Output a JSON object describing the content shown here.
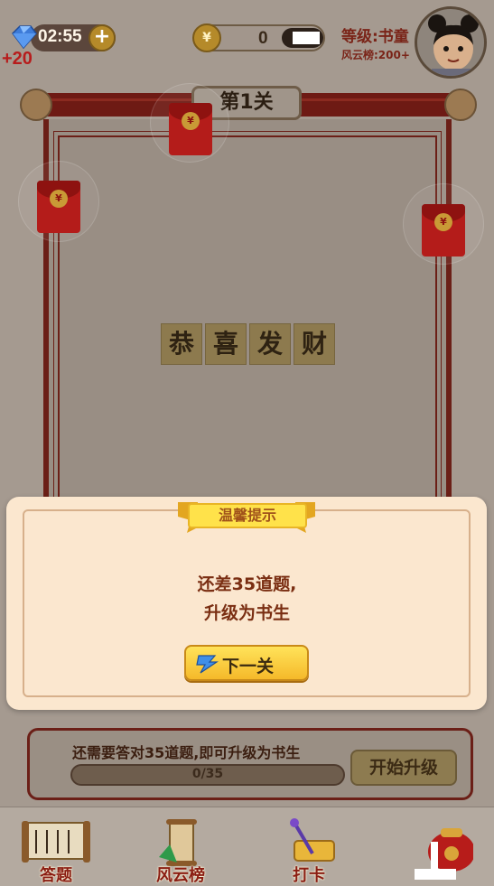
{
  "header": {
    "timer": "02:55",
    "plus": "+",
    "energy_delta": "+20",
    "coin_symbol": "¥",
    "coins": "0",
    "rank_level": "等级:书童",
    "rank_board": "风云榜:200+"
  },
  "level": {
    "title": "第1关"
  },
  "answer": {
    "chars": [
      "恭",
      "喜",
      "发",
      "财"
    ]
  },
  "envelope_seal": "¥",
  "dialog": {
    "title": "温馨提示",
    "message_line1": "还差35道题,",
    "message_line2": "升级为书生",
    "next_button": "下一关"
  },
  "upgrade": {
    "text": "还需要答对35道题,即可升级为书生",
    "progress_label": "0/35",
    "progress_value": 0,
    "progress_max": 35,
    "button": "开始升级"
  },
  "nav": [
    {
      "label": "答题",
      "icon": "scroll-book-icon"
    },
    {
      "label": "风云榜",
      "icon": "ranking-scroll-icon"
    },
    {
      "label": "打卡",
      "icon": "checkin-brush-icon"
    },
    {
      "label": "",
      "icon": "money-bag-icon"
    }
  ],
  "colors": {
    "accent_red": "#6b1f17",
    "gold": "#f5b92a",
    "dialog_bg": "#fbe7cf"
  }
}
